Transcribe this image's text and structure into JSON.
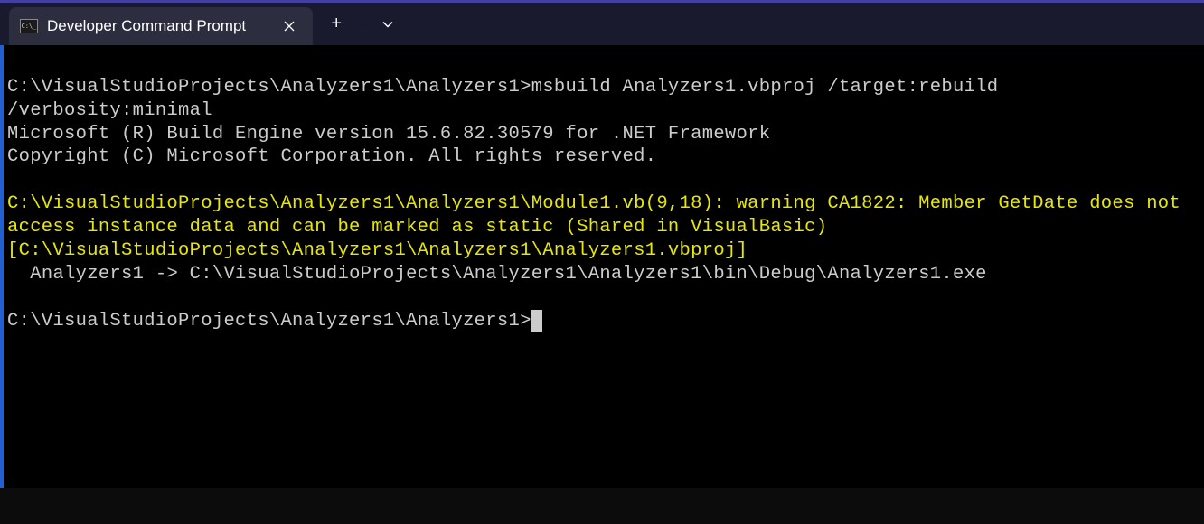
{
  "titlebar": {
    "tab_title": "Developer Command Prompt",
    "tab_icon_text": "C:\\_"
  },
  "terminal": {
    "line1_prompt": "C:\\VisualStudioProjects\\Analyzers1\\Analyzers1>",
    "line1_cmd": "msbuild Analyzers1.vbproj /target:rebuild /verbosity:minimal",
    "line2": "Microsoft (R) Build Engine version 15.6.82.30579 for .NET Framework",
    "line3": "Copyright (C) Microsoft Corporation. All rights reserved.",
    "warning": "C:\\VisualStudioProjects\\Analyzers1\\Analyzers1\\Module1.vb(9,18): warning CA1822: Member GetDate does not access instance data and can be marked as static (Shared in VisualBasic) [C:\\VisualStudioProjects\\Analyzers1\\Analyzers1\\Analyzers1.vbproj]",
    "output": "  Analyzers1 -> C:\\VisualStudioProjects\\Analyzers1\\Analyzers1\\bin\\Debug\\Analyzers1.exe",
    "prompt2": "C:\\VisualStudioProjects\\Analyzers1\\Analyzers1>"
  }
}
